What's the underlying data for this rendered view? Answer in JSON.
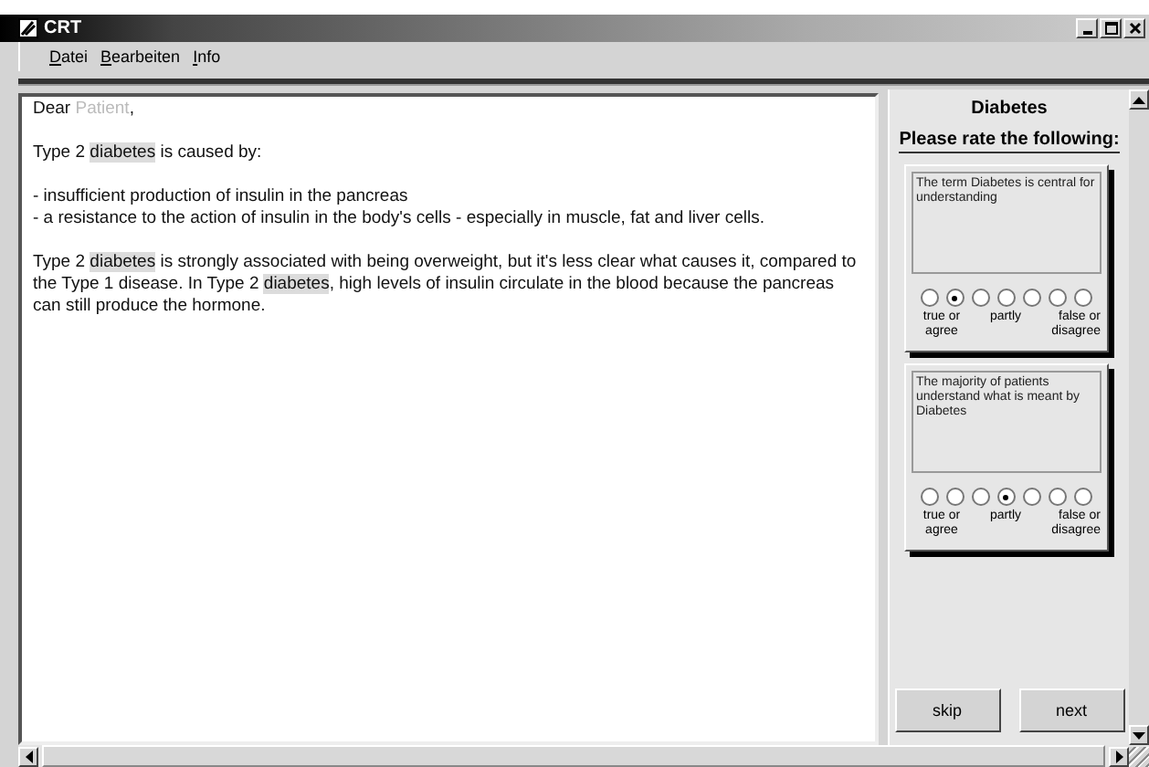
{
  "window": {
    "title": "CRT"
  },
  "menu": [
    "Datei",
    "Bearbeiten",
    "Info"
  ],
  "letter": {
    "blocks": [
      [
        [
          {
            "text": "Dear ",
            "kind": "plain"
          },
          {
            "text": "Patient",
            "kind": "faded"
          },
          {
            "text": ",",
            "kind": "plain"
          }
        ]
      ],
      [
        [
          {
            "text": "Type 2 ",
            "kind": "plain"
          },
          {
            "text": "diabetes",
            "kind": "term"
          },
          {
            "text": " is caused by:",
            "kind": "plain"
          }
        ]
      ],
      [
        [
          {
            "text": "- insufficient production of insulin in the pancreas",
            "kind": "plain"
          }
        ],
        [
          {
            "text": "- a resistance to the action of insulin in the body's cells - especially in muscle, fat and liver cells.",
            "kind": "plain"
          }
        ]
      ],
      [
        [
          {
            "text": "Type 2 ",
            "kind": "plain"
          },
          {
            "text": "diabetes",
            "kind": "term"
          },
          {
            "text": " is strongly associated with being overweight, but it's less clear what causes it, compared to the Type 1 disease. In Type 2 ",
            "kind": "plain"
          },
          {
            "text": "diabetes",
            "kind": "term"
          },
          {
            "text": ", high levels of insulin circulate in the blood because the pancreas can still produce the hormone.",
            "kind": "plain"
          }
        ]
      ]
    ]
  },
  "panel": {
    "title": "Diabetes",
    "subtitle": "Please rate the following:",
    "questions": [
      {
        "text": "The term Diabetes is central for understanding",
        "options": [
          {
            "selected": false
          },
          {
            "selected": true
          },
          {
            "selected": false
          },
          {
            "selected": false
          },
          {
            "selected": false
          },
          {
            "selected": false
          },
          {
            "selected": false
          }
        ],
        "labels": [
          "true or agree",
          "partly",
          "false or disagree"
        ]
      },
      {
        "text": "The majority of patients understand what is meant by Diabetes",
        "options": [
          {
            "selected": false
          },
          {
            "selected": false
          },
          {
            "selected": false
          },
          {
            "selected": true
          },
          {
            "selected": false
          },
          {
            "selected": false
          },
          {
            "selected": false
          }
        ],
        "labels": [
          "true or agree",
          "partly",
          "false or disagree"
        ]
      }
    ],
    "buttons": [
      "skip",
      "next"
    ]
  }
}
